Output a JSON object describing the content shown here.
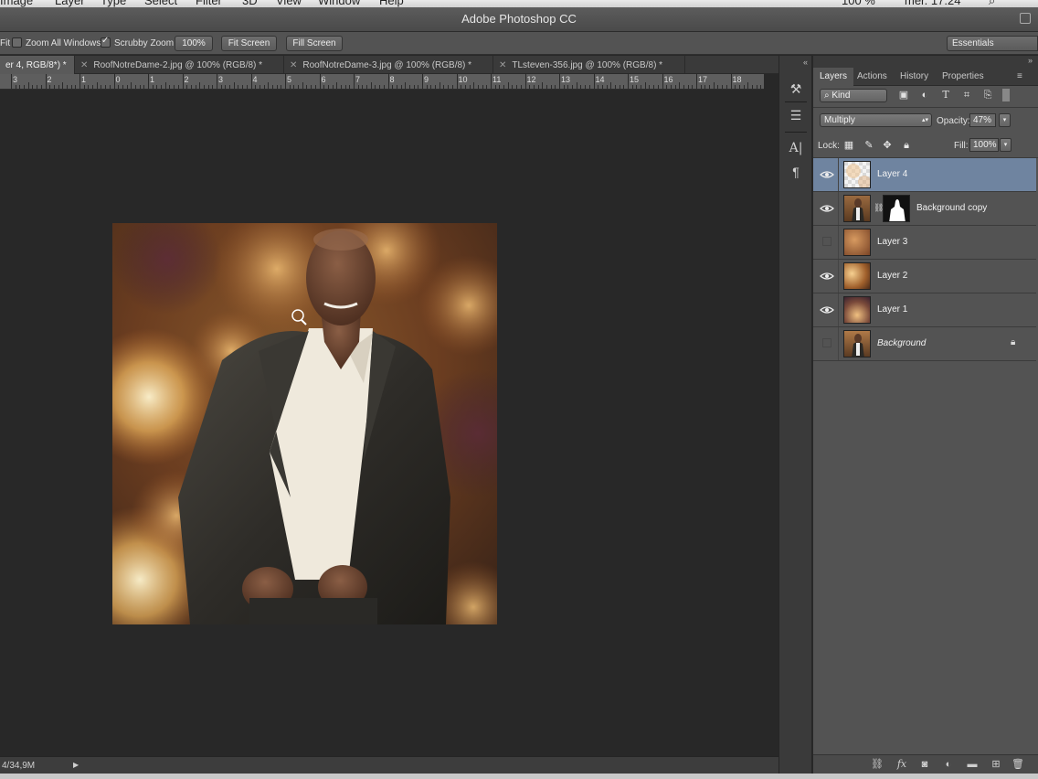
{
  "menubar": {
    "items": [
      "Image",
      "Layer",
      "Type",
      "Select",
      "Filter",
      "3D",
      "View",
      "Window",
      "Help"
    ],
    "right_text": [
      "100 %",
      "mer. 17:24"
    ]
  },
  "window": {
    "title": "Adobe Photoshop CC"
  },
  "options": {
    "fit_label": "Fit",
    "zoom_all_windows": "Zoom All Windows",
    "scrubby_zoom": "Scrubby Zoom",
    "btn_100": "100%",
    "btn_fit": "Fit Screen",
    "btn_fill": "Fill Screen",
    "workspace": "Essentials"
  },
  "tabs": [
    {
      "label": "er 4, RGB/8*) *",
      "active": true
    },
    {
      "label": "RoofNotreDame-2.jpg @ 100% (RGB/8) *",
      "active": false
    },
    {
      "label": "RoofNotreDame-3.jpg @ 100% (RGB/8) *",
      "active": false
    },
    {
      "label": "TLsteven-356.jpg @ 100% (RGB/8) *",
      "active": false
    }
  ],
  "ruler": {
    "labels": [
      "3",
      "2",
      "1",
      "0",
      "1",
      "2",
      "3",
      "4",
      "5",
      "6",
      "7",
      "8",
      "9",
      "10",
      "11",
      "12",
      "13",
      "14",
      "15",
      "16",
      "17",
      "18"
    ]
  },
  "status": {
    "doc_size": "4/34,9M"
  },
  "panel": {
    "tabs": [
      "Layers",
      "Actions",
      "History",
      "Properties"
    ],
    "kind": "Kind",
    "blend_mode": "Multiply",
    "opacity_label": "Opacity:",
    "opacity_value": "47%",
    "lock_label": "Lock:",
    "fill_label": "Fill:",
    "fill_value": "100%",
    "layers": [
      {
        "name": "Layer 4",
        "visible": true,
        "selected": true,
        "italic": false
      },
      {
        "name": "Background copy",
        "visible": true,
        "selected": false,
        "italic": false,
        "has_mask": true
      },
      {
        "name": "Layer 3",
        "visible": false,
        "selected": false,
        "italic": false
      },
      {
        "name": "Layer 2",
        "visible": true,
        "selected": false,
        "italic": false
      },
      {
        "name": "Layer 1",
        "visible": true,
        "selected": false,
        "italic": false
      },
      {
        "name": "Background",
        "visible": false,
        "selected": false,
        "italic": true,
        "locked": true
      }
    ]
  },
  "colors": {
    "selection": "#6f84a0",
    "panel": "#535353",
    "canvas": "#282828"
  }
}
